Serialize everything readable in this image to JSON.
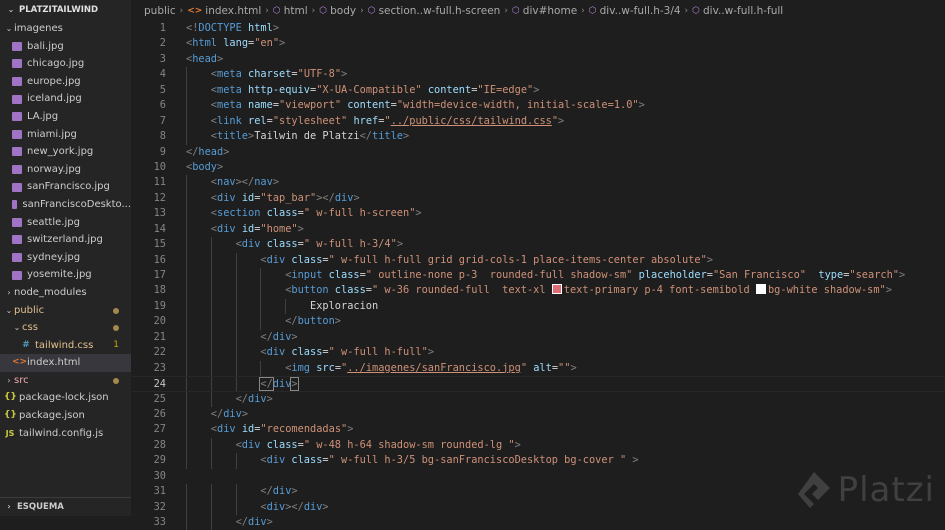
{
  "explorer": {
    "project": "PLATZITAILWIND",
    "items": [
      {
        "label": "imagenes",
        "kind": "folder",
        "open": true,
        "depth": 0
      },
      {
        "label": "bali.jpg",
        "kind": "img",
        "depth": 1
      },
      {
        "label": "chicago.jpg",
        "kind": "img",
        "depth": 1
      },
      {
        "label": "europe.jpg",
        "kind": "img",
        "depth": 1
      },
      {
        "label": "iceland.jpg",
        "kind": "img",
        "depth": 1
      },
      {
        "label": "LA.jpg",
        "kind": "img",
        "depth": 1
      },
      {
        "label": "miami.jpg",
        "kind": "img",
        "depth": 1
      },
      {
        "label": "new_york.jpg",
        "kind": "img",
        "depth": 1
      },
      {
        "label": "norway.jpg",
        "kind": "img",
        "depth": 1
      },
      {
        "label": "sanFrancisco.jpg",
        "kind": "img",
        "depth": 1
      },
      {
        "label": "sanFranciscoDeskto...",
        "kind": "img",
        "depth": 1
      },
      {
        "label": "seattle.jpg",
        "kind": "img",
        "depth": 1
      },
      {
        "label": "switzerland.jpg",
        "kind": "img",
        "depth": 1
      },
      {
        "label": "sydney.jpg",
        "kind": "img",
        "depth": 1
      },
      {
        "label": "yosemite.jpg",
        "kind": "img",
        "depth": 1
      },
      {
        "label": "node_modules",
        "kind": "folder",
        "open": false,
        "depth": 0
      },
      {
        "label": "public",
        "kind": "folder",
        "open": true,
        "depth": 0,
        "color": "orange",
        "dot": true
      },
      {
        "label": "css",
        "kind": "folder",
        "open": true,
        "depth": 1,
        "color": "orange",
        "dot": true
      },
      {
        "label": "tailwind.css",
        "kind": "css",
        "depth": 2,
        "color": "orange",
        "badge": "1"
      },
      {
        "label": "index.html",
        "kind": "html",
        "depth": 1,
        "active": true
      },
      {
        "label": "src",
        "kind": "folder",
        "open": false,
        "depth": 0,
        "color": "pink",
        "dot": true
      },
      {
        "label": "package-lock.json",
        "kind": "json",
        "depth": 0
      },
      {
        "label": "package.json",
        "kind": "json",
        "depth": 0
      },
      {
        "label": "tailwind.config.js",
        "kind": "js",
        "depth": 0
      }
    ],
    "footer": "ESQUEMA"
  },
  "breadcrumb": {
    "items": [
      "public",
      "index.html",
      "html",
      "body",
      "section..w-full.h-screen",
      "div#home",
      "div..w-full.h-3/4",
      "div..w-full.h-full"
    ]
  },
  "editor": {
    "current_line": 24,
    "lines": [
      {
        "n": "1",
        "i": 0,
        "t": [
          [
            "br",
            "<!"
          ],
          [
            "tag",
            "DOCTYPE"
          ],
          [
            "txt",
            " "
          ],
          [
            "attr",
            "html"
          ],
          [
            "br",
            ">"
          ]
        ]
      },
      {
        "n": "2",
        "i": 0,
        "t": [
          [
            "br",
            "<"
          ],
          [
            "tag",
            "html"
          ],
          [
            "txt",
            " "
          ],
          [
            "attr",
            "lang"
          ],
          [
            "txt",
            "="
          ],
          [
            "str",
            "\"en\""
          ],
          [
            "br",
            ">"
          ]
        ]
      },
      {
        "n": "3",
        "i": 0,
        "t": [
          [
            "br",
            "<"
          ],
          [
            "tag",
            "head"
          ],
          [
            "br",
            ">"
          ]
        ]
      },
      {
        "n": "4",
        "i": 1,
        "t": [
          [
            "br",
            "<"
          ],
          [
            "tag",
            "meta"
          ],
          [
            "txt",
            " "
          ],
          [
            "attr",
            "charset"
          ],
          [
            "txt",
            "="
          ],
          [
            "str",
            "\"UTF-8\""
          ],
          [
            "br",
            ">"
          ]
        ]
      },
      {
        "n": "5",
        "i": 1,
        "t": [
          [
            "br",
            "<"
          ],
          [
            "tag",
            "meta"
          ],
          [
            "txt",
            " "
          ],
          [
            "attr",
            "http-equiv"
          ],
          [
            "txt",
            "="
          ],
          [
            "str",
            "\"X-UA-Compatible\""
          ],
          [
            "txt",
            " "
          ],
          [
            "attr",
            "content"
          ],
          [
            "txt",
            "="
          ],
          [
            "str",
            "\"IE=edge\""
          ],
          [
            "br",
            ">"
          ]
        ]
      },
      {
        "n": "6",
        "i": 1,
        "t": [
          [
            "br",
            "<"
          ],
          [
            "tag",
            "meta"
          ],
          [
            "txt",
            " "
          ],
          [
            "attr",
            "name"
          ],
          [
            "txt",
            "="
          ],
          [
            "str",
            "\"viewport\""
          ],
          [
            "txt",
            " "
          ],
          [
            "attr",
            "content"
          ],
          [
            "txt",
            "="
          ],
          [
            "str",
            "\"width=device-width, initial-scale=1.0\""
          ],
          [
            "br",
            ">"
          ]
        ]
      },
      {
        "n": "7",
        "i": 1,
        "t": [
          [
            "br",
            "<"
          ],
          [
            "tag",
            "link"
          ],
          [
            "txt",
            " "
          ],
          [
            "attr",
            "rel"
          ],
          [
            "txt",
            "="
          ],
          [
            "str",
            "\"stylesheet\""
          ],
          [
            "txt",
            " "
          ],
          [
            "attr",
            "href"
          ],
          [
            "txt",
            "="
          ],
          [
            "str",
            "\""
          ],
          [
            "link",
            "../public/css/tailwind.css"
          ],
          [
            "str",
            "\""
          ],
          [
            "br",
            ">"
          ]
        ]
      },
      {
        "n": "8",
        "i": 1,
        "t": [
          [
            "br",
            "<"
          ],
          [
            "tag",
            "title"
          ],
          [
            "br",
            ">"
          ],
          [
            "txt",
            "Tailwin de Platzi"
          ],
          [
            "br",
            "</"
          ],
          [
            "tag",
            "title"
          ],
          [
            "br",
            ">"
          ]
        ]
      },
      {
        "n": "9",
        "i": 0,
        "t": [
          [
            "br",
            "</"
          ],
          [
            "tag",
            "head"
          ],
          [
            "br",
            ">"
          ]
        ]
      },
      {
        "n": "10",
        "i": 0,
        "t": [
          [
            "br",
            "<"
          ],
          [
            "tag",
            "body"
          ],
          [
            "br",
            ">"
          ]
        ]
      },
      {
        "n": "11",
        "i": 1,
        "t": [
          [
            "br",
            "<"
          ],
          [
            "tag",
            "nav"
          ],
          [
            "br",
            "></"
          ],
          [
            "tag",
            "nav"
          ],
          [
            "br",
            ">"
          ]
        ]
      },
      {
        "n": "12",
        "i": 1,
        "t": [
          [
            "br",
            "<"
          ],
          [
            "tag",
            "div"
          ],
          [
            "txt",
            " "
          ],
          [
            "attr",
            "id"
          ],
          [
            "txt",
            "="
          ],
          [
            "str",
            "\"tap_bar\""
          ],
          [
            "br",
            "></"
          ],
          [
            "tag",
            "div"
          ],
          [
            "br",
            ">"
          ]
        ]
      },
      {
        "n": "13",
        "i": 1,
        "t": [
          [
            "br",
            "<"
          ],
          [
            "tag",
            "section"
          ],
          [
            "txt",
            " "
          ],
          [
            "attr",
            "class"
          ],
          [
            "txt",
            "="
          ],
          [
            "str",
            "\" w-full h-screen\""
          ],
          [
            "br",
            ">"
          ]
        ]
      },
      {
        "n": "14",
        "i": 1,
        "t": [
          [
            "br",
            "<"
          ],
          [
            "tag",
            "div"
          ],
          [
            "txt",
            " "
          ],
          [
            "attr",
            "id"
          ],
          [
            "txt",
            "="
          ],
          [
            "str",
            "\"home\""
          ],
          [
            "br",
            ">"
          ]
        ]
      },
      {
        "n": "15",
        "i": 2,
        "t": [
          [
            "br",
            "<"
          ],
          [
            "tag",
            "div"
          ],
          [
            "txt",
            " "
          ],
          [
            "attr",
            "class"
          ],
          [
            "txt",
            "="
          ],
          [
            "str",
            "\" w-full h-3/4\""
          ],
          [
            "br",
            ">"
          ]
        ]
      },
      {
        "n": "16",
        "i": 3,
        "t": [
          [
            "br",
            "<"
          ],
          [
            "tag",
            "div"
          ],
          [
            "txt",
            " "
          ],
          [
            "attr",
            "class"
          ],
          [
            "txt",
            "="
          ],
          [
            "str",
            "\" w-full h-full grid grid-cols-1 place-items-center absolute\""
          ],
          [
            "br",
            ">"
          ]
        ]
      },
      {
        "n": "17",
        "i": 4,
        "t": [
          [
            "br",
            "<"
          ],
          [
            "tag",
            "input"
          ],
          [
            "txt",
            " "
          ],
          [
            "attr",
            "class"
          ],
          [
            "txt",
            "="
          ],
          [
            "str",
            "\" outline-none p-3  rounded-full shadow-sm\""
          ],
          [
            "txt",
            " "
          ],
          [
            "attr",
            "placeholder"
          ],
          [
            "txt",
            "="
          ],
          [
            "str",
            "\"San Francisco\""
          ],
          [
            "txt",
            "  "
          ],
          [
            "attr",
            "type"
          ],
          [
            "txt",
            "="
          ],
          [
            "str",
            "\"search\""
          ],
          [
            "br",
            ">"
          ]
        ]
      },
      {
        "n": "18",
        "i": 4,
        "t": [
          [
            "br",
            "<"
          ],
          [
            "tag",
            "button"
          ],
          [
            "txt",
            " "
          ],
          [
            "attr",
            "class"
          ],
          [
            "txt",
            "="
          ],
          [
            "str",
            "\" w-36 rounded-full  text-xl "
          ],
          [
            "sw",
            "#e06c75"
          ],
          [
            "str",
            "text-primary p-4 font-semibold "
          ],
          [
            "sw",
            "#ffffff"
          ],
          [
            "str",
            "bg-white shadow-sm\""
          ],
          [
            "br",
            ">"
          ]
        ]
      },
      {
        "n": "19",
        "i": 5,
        "t": [
          [
            "txt",
            "Exploracion"
          ]
        ]
      },
      {
        "n": "20",
        "i": 4,
        "t": [
          [
            "br",
            "</"
          ],
          [
            "tag",
            "button"
          ],
          [
            "br",
            ">"
          ]
        ]
      },
      {
        "n": "21",
        "i": 3,
        "t": [
          [
            "br",
            "</"
          ],
          [
            "tag",
            "div"
          ],
          [
            "br",
            ">"
          ]
        ]
      },
      {
        "n": "22",
        "i": 3,
        "t": [
          [
            "br",
            "<"
          ],
          [
            "tag",
            "div"
          ],
          [
            "txt",
            " "
          ],
          [
            "attr",
            "class"
          ],
          [
            "txt",
            "="
          ],
          [
            "str",
            "\" w-full h-full\""
          ],
          [
            "br",
            ">"
          ]
        ]
      },
      {
        "n": "23",
        "i": 4,
        "t": [
          [
            "br",
            "<"
          ],
          [
            "tag",
            "img"
          ],
          [
            "txt",
            " "
          ],
          [
            "attr",
            "src"
          ],
          [
            "txt",
            "="
          ],
          [
            "str",
            "\""
          ],
          [
            "link",
            "../imagenes/sanFrancisco.jpg"
          ],
          [
            "str",
            "\""
          ],
          [
            "txt",
            " "
          ],
          [
            "attr",
            "alt"
          ],
          [
            "txt",
            "="
          ],
          [
            "str",
            "\"\""
          ],
          [
            "br",
            ">"
          ]
        ]
      },
      {
        "n": "24",
        "i": 3,
        "t": [
          [
            "hl",
            "</"
          ],
          [
            "tag",
            "div"
          ],
          [
            "hl",
            ">"
          ]
        ]
      },
      {
        "n": "25",
        "i": 2,
        "t": [
          [
            "br",
            "</"
          ],
          [
            "tag",
            "div"
          ],
          [
            "br",
            ">"
          ]
        ]
      },
      {
        "n": "26",
        "i": 1,
        "t": [
          [
            "br",
            "</"
          ],
          [
            "tag",
            "div"
          ],
          [
            "br",
            ">"
          ]
        ]
      },
      {
        "n": "27",
        "i": 1,
        "t": [
          [
            "br",
            "<"
          ],
          [
            "tag",
            "div"
          ],
          [
            "txt",
            " "
          ],
          [
            "attr",
            "id"
          ],
          [
            "txt",
            "="
          ],
          [
            "str",
            "\"recomendadas\""
          ],
          [
            "br",
            ">"
          ]
        ]
      },
      {
        "n": "28",
        "i": 2,
        "t": [
          [
            "br",
            "<"
          ],
          [
            "tag",
            "div"
          ],
          [
            "txt",
            " "
          ],
          [
            "attr",
            "class"
          ],
          [
            "txt",
            "="
          ],
          [
            "str",
            "\" w-48 h-64 shadow-sm rounded-lg \""
          ],
          [
            "br",
            ">"
          ]
        ]
      },
      {
        "n": "29",
        "i": 3,
        "t": [
          [
            "br",
            "<"
          ],
          [
            "tag",
            "div"
          ],
          [
            "txt",
            " "
          ],
          [
            "attr",
            "class"
          ],
          [
            "txt",
            "="
          ],
          [
            "str",
            "\" w-full h-3/5 bg-sanFranciscoDesktop bg-cover \""
          ],
          [
            "txt",
            " "
          ],
          [
            "br",
            ">"
          ]
        ]
      },
      {
        "n": "30",
        "i": 0,
        "t": []
      },
      {
        "n": "31",
        "i": 3,
        "t": [
          [
            "br",
            "</"
          ],
          [
            "tag",
            "div"
          ],
          [
            "br",
            ">"
          ]
        ]
      },
      {
        "n": "32",
        "i": 3,
        "t": [
          [
            "br",
            "<"
          ],
          [
            "tag",
            "div"
          ],
          [
            "br",
            "></"
          ],
          [
            "tag",
            "div"
          ],
          [
            "br",
            ">"
          ]
        ]
      },
      {
        "n": "33",
        "i": 2,
        "t": [
          [
            "br",
            "</"
          ],
          [
            "tag",
            "div"
          ],
          [
            "br",
            ">"
          ]
        ]
      }
    ]
  },
  "watermark": {
    "text": "Platzi"
  }
}
